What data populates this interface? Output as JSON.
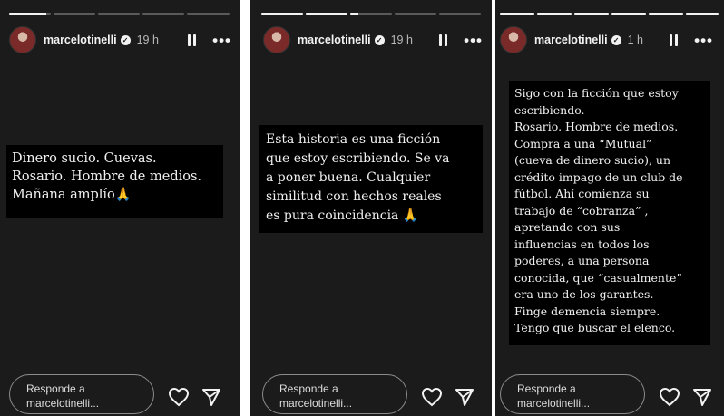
{
  "stories": [
    {
      "progress": [
        0.9,
        0,
        0,
        0,
        0
      ],
      "username": "marcelotinelli",
      "time": "19 h",
      "text": "Dinero sucio. Cuevas.\nRosario. Hombre de medios.\nMañana amplío🙏",
      "reply_placeholder": "Responde a\nmarcelotinelli..."
    },
    {
      "progress": [
        1,
        1,
        0.2,
        0,
        0
      ],
      "username": "marcelotinelli",
      "time": "19 h",
      "text": "Esta historia es una ficción\nque estoy escribiendo. Se va\na poner buena. Cualquier\nsimilitud con hechos reales\nes pura coincidencia 🙏",
      "reply_placeholder": "Responde a\nmarcelotinelli..."
    },
    {
      "progress": [
        1,
        1,
        1,
        1,
        1,
        1
      ],
      "username": "marcelotinelli",
      "time": "1 h",
      "text": "Sigo con la ficción que estoy\nescribiendo.\nRosario. Hombre de medios.\nCompra a una “Mutual”\n(cueva de dinero sucio), un\ncrédito impago de un club de\nfútbol. Ahí comienza su\ntrabajo de “cobranza” ,\napretando con sus\ninfluencias en todos los\npoderes, a una persona\nconocida, que “casualmente”\nera uno de los garantes.\nFinge demencia siempre.\nTengo que buscar el elenco.",
      "reply_placeholder": "Responde a\nmarcelotinelli..."
    }
  ],
  "icons": {
    "verified": "verified-badge-icon",
    "pause": "pause-icon",
    "more": "more-options-icon",
    "like": "heart-icon",
    "share": "send-icon"
  },
  "colors": {
    "story_background": "#1b1b1b",
    "text_box": "#000000",
    "text": "#f0f0f0"
  }
}
